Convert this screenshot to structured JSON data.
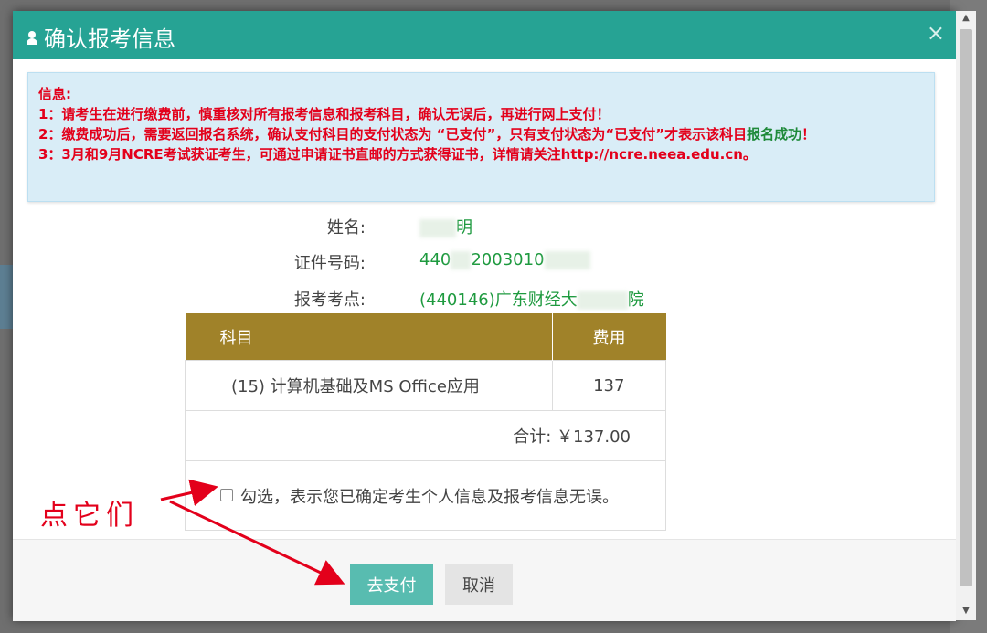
{
  "modal": {
    "title": "确认报考信息",
    "close_label": "×"
  },
  "notice": {
    "heading": "信息:",
    "line1": "1：请考生在进行缴费前，慎重核对所有报考信息和报考科目，确认无误后，再进行网上支付！",
    "line2_a": "2：缴费成功后，需要返回报名系统，确认支付科目的支付状态为 “已支付”，只有支付状态为“已支付”才表示该科目",
    "line2_b": "报名成功",
    "line2_c": "！",
    "line3": "3：3月和9月NCRE考试获证考生，可通过申请证书直邮的方式获得证书，详情请关注http://ncre.neea.edu.cn。"
  },
  "fields": {
    "name_label": "姓名:",
    "name_value_end": "明",
    "id_label": "证件号码:",
    "id_value_a": "440",
    "id_value_b": "2003010",
    "center_label": "报考考点:",
    "center_value_a": "(440146)广东财经大",
    "center_value_b": "院"
  },
  "fee_table": {
    "col_subject": "科目",
    "col_fee": "费用",
    "subject": "(15) 计算机基础及MS Office应用",
    "fee": "137",
    "total_label": "合计:",
    "total_value": "￥137.00",
    "confirm_text": "勾选，表示您已确定考生个人信息及报考信息无误。"
  },
  "buttons": {
    "pay": "去支付",
    "cancel": "取消"
  },
  "annotation": {
    "text": "点它们",
    "color": "#e3001b"
  },
  "colors": {
    "header": "#26a394",
    "table_header": "#a08229",
    "pay_button": "#58bcb0",
    "notice_text": "#e3001b",
    "value_text": "#1e9a3f"
  }
}
